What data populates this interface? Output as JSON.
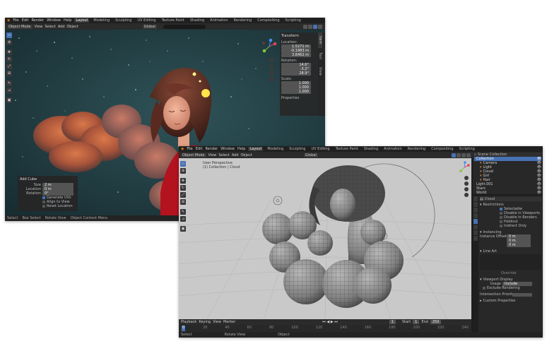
{
  "window1": {
    "menus": [
      "File",
      "Edit",
      "Render",
      "Window",
      "Help"
    ],
    "workspace_tabs": [
      "Layout",
      "Modeling",
      "Sculpting",
      "UV Editing",
      "Texture Paint",
      "Shading",
      "Animation",
      "Rendering",
      "Compositing",
      "Scripting"
    ],
    "viewport_header": [
      "Object Mode",
      "View",
      "Select",
      "Add",
      "Object",
      "Global"
    ],
    "search_placeholder": "",
    "npanel": {
      "title": "Transform",
      "location_label": "Location:",
      "location": [
        "1.5271 m",
        "-0.1983 m",
        "3.8462 m"
      ],
      "rotation_label": "Rotation:",
      "rotation": [
        "14.6°",
        "-3.2°",
        "28.9°"
      ],
      "scale_label": "Scale:",
      "scale": [
        "1.000",
        "1.000",
        "1.000"
      ],
      "properties_label": "Properties",
      "tabs": [
        "Item",
        "Tool",
        "View"
      ]
    },
    "popup": {
      "title": "Add Cube",
      "rows": [
        {
          "label": "Size",
          "value": "2 m"
        },
        {
          "label": "Location",
          "value": "0 m"
        },
        {
          "label": "Rotation",
          "value": "0°"
        }
      ],
      "options": [
        "Generate UVs",
        "Align to View",
        "Reset Location"
      ]
    },
    "status_items": [
      "Select",
      "Box Select",
      "Rotate View",
      "Object Context Menu"
    ]
  },
  "window2": {
    "menus": [
      "File",
      "Edit",
      "Render",
      "Window",
      "Help"
    ],
    "workspace_tabs": [
      "Layout",
      "Modeling",
      "Sculpting",
      "UV Editing",
      "Texture Paint",
      "Shading",
      "Animation",
      "Rendering",
      "Compositing",
      "Scripting"
    ],
    "viewport_header": [
      "Object Mode",
      "View",
      "Select",
      "Add",
      "Object",
      "Global"
    ],
    "viewport_info": [
      "User Perspective",
      "(1) Collection | Cloud"
    ],
    "outliner": {
      "title": "Scene Collection",
      "items": [
        {
          "name": "Collection",
          "selected": true
        },
        {
          "name": "Camera",
          "selected": false
        },
        {
          "name": "Light",
          "selected": false
        },
        {
          "name": "Cloud",
          "selected": false
        },
        {
          "name": "Girl",
          "selected": false
        },
        {
          "name": "Hair",
          "selected": false
        },
        {
          "name": "Light.001",
          "selected": false
        },
        {
          "name": "Stars",
          "selected": false
        },
        {
          "name": "World",
          "selected": false
        }
      ]
    },
    "properties": {
      "object_name": "Cloud",
      "sections": [
        "Restrictions",
        "Instancing",
        "Viewport Display",
        "Custom Properties",
        "Collection"
      ],
      "checkboxes": [
        "Selectable",
        "Disable in Viewports",
        "Disable in Renders",
        "Holdout",
        "Indirect Only"
      ],
      "instance_offset_label": "Instance Offset",
      "offset_values": [
        "0 m",
        "0 m",
        "0 m"
      ],
      "lineart_label": "Line Art",
      "usage_label": "Usage",
      "usage_value": "Include",
      "intersection_label": "Intersection Priority",
      "exclusion_label": "Exclude Rendering",
      "sub_label": "Override"
    },
    "timeline": {
      "items": [
        "Playback",
        "Keying",
        "View",
        "Marker"
      ],
      "frame_start_label": "Start",
      "frame_start": "1",
      "frame_end_label": "End",
      "frame_end": "250",
      "current_frame": "1",
      "ticks": [
        "0",
        "20",
        "40",
        "60",
        "80",
        "100",
        "120",
        "140",
        "160",
        "180",
        "200",
        "220",
        "240"
      ]
    },
    "status_items": [
      "Select",
      "Rotate View",
      "Object"
    ]
  }
}
